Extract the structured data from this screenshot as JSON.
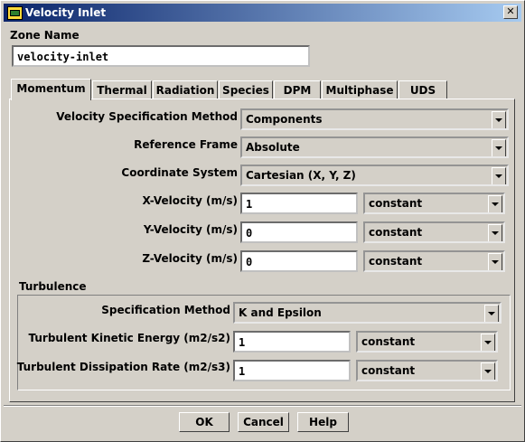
{
  "window": {
    "title": "Velocity Inlet"
  },
  "zone": {
    "label": "Zone Name",
    "value": "velocity-inlet"
  },
  "tabs": [
    {
      "label": "Momentum"
    },
    {
      "label": "Thermal"
    },
    {
      "label": "Radiation"
    },
    {
      "label": "Species"
    },
    {
      "label": "DPM"
    },
    {
      "label": "Multiphase"
    },
    {
      "label": "UDS"
    }
  ],
  "momentum": {
    "velocity_spec": {
      "label": "Velocity Specification Method",
      "value": "Components"
    },
    "reference_frame": {
      "label": "Reference Frame",
      "value": "Absolute"
    },
    "coordinate_system": {
      "label": "Coordinate System",
      "value": "Cartesian (X, Y, Z)"
    },
    "x_velocity": {
      "label": "X-Velocity (m/s)",
      "value": "1",
      "profile": "constant"
    },
    "y_velocity": {
      "label": "Y-Velocity (m/s)",
      "value": "0",
      "profile": "constant"
    },
    "z_velocity": {
      "label": "Z-Velocity (m/s)",
      "value": "0",
      "profile": "constant"
    }
  },
  "turbulence": {
    "title": "Turbulence",
    "spec_method": {
      "label": "Specification Method",
      "value": "K and Epsilon"
    },
    "tke": {
      "label": "Turbulent Kinetic Energy (m2/s2)",
      "value": "1",
      "profile": "constant"
    },
    "tdr": {
      "label": "Turbulent Dissipation Rate (m2/s3)",
      "value": "1",
      "profile": "constant"
    }
  },
  "buttons": {
    "ok": "OK",
    "cancel": "Cancel",
    "help": "Help"
  },
  "icons": {
    "app": "fluent-app-icon",
    "close": "close-icon",
    "dropdown": "chevron-down-icon"
  },
  "colors": {
    "face": "#d4d0c8",
    "titlebar": "#0a246a"
  }
}
